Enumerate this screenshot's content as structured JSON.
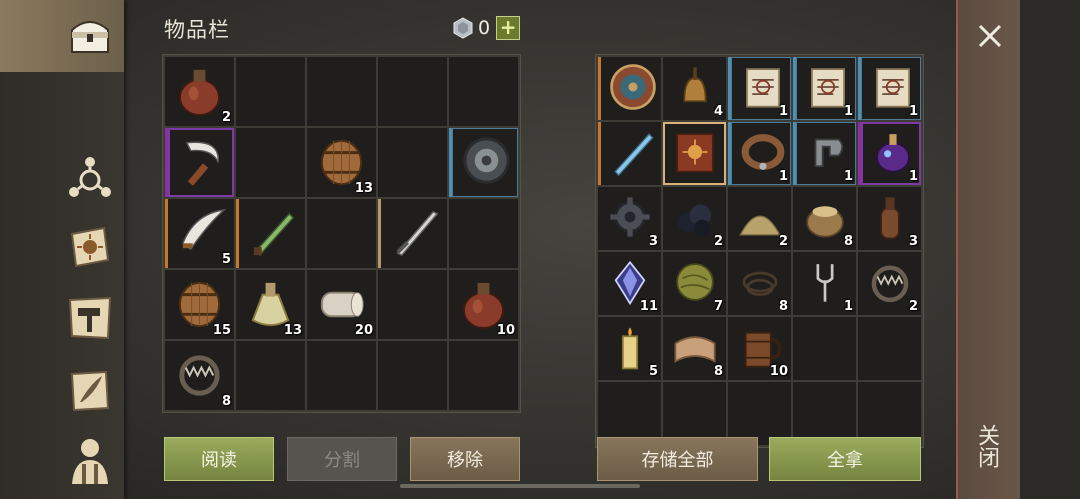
{
  "header": {
    "title": "物品栏",
    "currency_value": "0",
    "currency_plus": "+"
  },
  "inventory": {
    "rows": [
      [
        {
          "icon": "flask-icon",
          "count": "2"
        },
        {},
        {},
        {},
        {}
      ],
      [
        {
          "icon": "sickle-icon",
          "rarity": "purple"
        },
        {},
        {
          "icon": "barrel-icon",
          "count": "13"
        },
        {},
        {
          "icon": "shield-icon",
          "rarity": "blue"
        }
      ],
      [
        {
          "icon": "scimitar-icon",
          "rarity": "orange",
          "count": "5",
          "dagger": true
        },
        {
          "icon": "poison-blade-icon",
          "rarity": "orange"
        },
        {},
        {
          "icon": "sword-icon",
          "rarity": "tan"
        },
        {}
      ],
      [
        {
          "icon": "barrel-icon",
          "count": "15"
        },
        {
          "icon": "potion-icon",
          "count": "13"
        },
        {
          "icon": "cloth-roll-icon",
          "count": "20"
        },
        {},
        {
          "icon": "flask-icon",
          "count": "10"
        }
      ],
      [
        {
          "icon": "bear-trap-icon",
          "count": "8"
        },
        {},
        {},
        {},
        {}
      ]
    ]
  },
  "storage": {
    "rows": [
      [
        {
          "icon": "round-shield-icon",
          "rarity": "orange"
        },
        {
          "icon": "bell-icon",
          "count": "4"
        },
        {
          "icon": "scroll-icon",
          "count": "1",
          "rarity": "blue"
        },
        {
          "icon": "scroll-icon",
          "count": "1",
          "rarity": "blue"
        },
        {
          "icon": "scroll-icon",
          "count": "1",
          "rarity": "blue"
        }
      ],
      [
        {
          "icon": "ice-sword-icon",
          "rarity": "orange"
        },
        {
          "icon": "sun-book-icon",
          "selected": true
        },
        {
          "icon": "collar-icon",
          "count": "1",
          "rarity": "blue"
        },
        {
          "icon": "clamp-icon",
          "count": "1",
          "rarity": "blue"
        },
        {
          "icon": "magic-potion-icon",
          "count": "1",
          "rarity": "purple"
        }
      ],
      [
        {
          "icon": "gear-icon",
          "count": "3"
        },
        {
          "icon": "coal-icon",
          "count": "2"
        },
        {
          "icon": "sand-pile-icon",
          "count": "2"
        },
        {
          "icon": "grain-sack-icon",
          "count": "8"
        },
        {
          "icon": "bottle-icon",
          "count": "3"
        }
      ],
      [
        {
          "icon": "crystal-icon",
          "count": "11"
        },
        {
          "icon": "moss-ball-icon",
          "count": "7"
        },
        {
          "icon": "rope-icon",
          "count": "8"
        },
        {
          "icon": "fork-icon",
          "count": "1"
        },
        {
          "icon": "bear-trap-icon",
          "count": "2"
        }
      ],
      [
        {
          "icon": "candle-icon",
          "count": "5"
        },
        {
          "icon": "fabric-icon",
          "count": "8"
        },
        {
          "icon": "mug-icon",
          "count": "10"
        },
        {},
        {}
      ],
      [
        {},
        {},
        {},
        {},
        {}
      ]
    ]
  },
  "buttons": {
    "read": "阅读",
    "split": "分割",
    "remove": "移除",
    "store_all": "存储全部",
    "take_all": "全拿"
  },
  "close": {
    "label": "关闭"
  },
  "colors": {
    "green_button": "#8a9a50",
    "orange_rarity": "#c9782a",
    "purple_rarity": "#8a2ea0",
    "blue_rarity": "#4c91b3"
  }
}
